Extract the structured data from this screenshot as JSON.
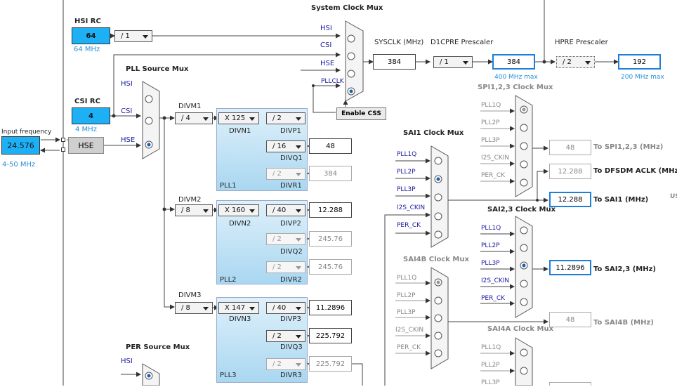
{
  "system_mux": {
    "title": "System Clock Mux",
    "inputs": [
      "HSI",
      "CSI",
      "HSE",
      "PLLCLK"
    ],
    "enable_css": "Enable CSS"
  },
  "hsi_rc": {
    "title": "HSI RC",
    "value": "64",
    "freq": "64 MHz",
    "div": "/ 1"
  },
  "csi_rc": {
    "title": "CSI RC",
    "value": "4",
    "freq": "4 MHz"
  },
  "input_freq": {
    "label": "Input frequency",
    "value": "24.576",
    "range": "4-50 MHz"
  },
  "hse_label": "HSE",
  "pll_source_mux": {
    "title": "PLL Source Mux",
    "inputs": [
      "HSI",
      "CSI",
      "HSE"
    ]
  },
  "per_source_mux": {
    "title": "PER Source Mux",
    "inputs": [
      "HSI"
    ]
  },
  "sysclk": {
    "label": "SYSCLK (MHz)",
    "value": "384"
  },
  "d1cpre": {
    "label": "D1CPRE Prescaler",
    "div": "/ 1",
    "value": "384",
    "max": "400 MHz max"
  },
  "hpre": {
    "label": "HPRE Prescaler",
    "div": "/ 2",
    "value": "192",
    "max": "200 MHz max"
  },
  "pll1": {
    "divm_label": "DIVM1",
    "divm": "/ 4",
    "divn": "X 125",
    "divn_label": "DIVN1",
    "divp": "/ 2",
    "divp_label": "DIVP1",
    "divq": "/ 16",
    "divq_label": "DIVQ1",
    "divq_out": "48",
    "divr": "/ 2",
    "divr_label": "DIVR1",
    "divr_out": "384",
    "name": "PLL1"
  },
  "pll2": {
    "divm_label": "DIVM2",
    "divm": "/ 8",
    "divn": "X 160",
    "divn_label": "DIVN2",
    "divp": "/ 40",
    "divp_label": "DIVP2",
    "divp_out": "12.288",
    "divq": "/ 2",
    "divq_label": "DIVQ2",
    "divq_out": "245.76",
    "divr": "/ 2",
    "divr_label": "DIVR2",
    "divr_out": "245.76",
    "name": "PLL2"
  },
  "pll3": {
    "divm_label": "DIVM3",
    "divm": "/ 8",
    "divn": "X 147",
    "divn_label": "DIVN3",
    "divp": "/ 40",
    "divp_label": "DIVP3",
    "divp_out": "11.2896",
    "divq": "/ 2",
    "divq_label": "DIVQ3",
    "divq_out": "225.792",
    "divr": "/ 2",
    "divr_label": "DIVR3",
    "divr_out": "225.792",
    "name": "PLL3"
  },
  "sai1_mux": {
    "title": "SAI1 Clock Mux",
    "inputs": [
      "PLL1Q",
      "PLL2P",
      "PLL3P",
      "I2S_CKIN",
      "PER_CK"
    ]
  },
  "sai4b_mux": {
    "title": "SAI4B Clock Mux",
    "inputs": [
      "PLL1Q",
      "PLL2P",
      "PLL3P",
      "I2S_CKIN",
      "PER_CK"
    ]
  },
  "spi_mux": {
    "title": "SPI1,2,3 Clock Mux",
    "inputs": [
      "PLL1Q",
      "PLL2P",
      "PLL3P",
      "I2S_CKIN",
      "PER_CK"
    ]
  },
  "sai23_mux": {
    "title": "SAI2,3 Clock Mux",
    "inputs": [
      "PLL1Q",
      "PLL2P",
      "PLL3P",
      "I2S_CKIN",
      "PER_CK"
    ]
  },
  "sai4a_mux": {
    "title": "SAI4A Clock Mux",
    "inputs": [
      "PLL1Q",
      "PLL2P",
      "PLL3P"
    ]
  },
  "outputs": {
    "spi": {
      "value": "48",
      "label": "To SPI1,2,3 (MHz)"
    },
    "dfsdm": {
      "value": "12.288",
      "label": "To DFSDM ACLK (MHz)"
    },
    "sai1": {
      "value": "12.288",
      "label": "To SAI1 (MHz)"
    },
    "sai23": {
      "value": "11.2896",
      "label": "To SAI2,3 (MHz)"
    },
    "sai4b": {
      "value": "48",
      "label": "To SAI4B (MHz)"
    }
  },
  "edge_label": "US"
}
